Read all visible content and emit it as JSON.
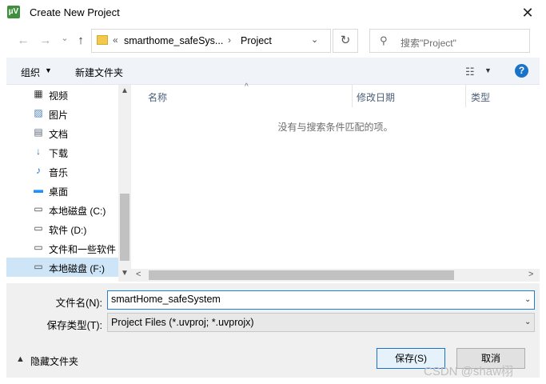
{
  "window": {
    "title": "Create New Project",
    "app_icon": "µV",
    "close_glyph": "✕"
  },
  "nav": {
    "back": "←",
    "forward": "→",
    "recent": "⌄",
    "up": "↑",
    "address": {
      "overflow": "«",
      "crumb1": "smarthome_safeSys...",
      "separator": "›",
      "crumb2": "Project",
      "dropdown": "⌄"
    },
    "refresh": "↻",
    "search_icon": "⚲",
    "search_placeholder": "搜索\"Project\""
  },
  "toolbar": {
    "organize": "组织",
    "organize_caret": "▼",
    "new_folder": "新建文件夹",
    "view_icon": "☷",
    "view_caret": "▼",
    "help": "?"
  },
  "sidebar": {
    "items": [
      {
        "label": "视频",
        "icon": "video-icon",
        "glyph": "▦",
        "color": "#333333"
      },
      {
        "label": "图片",
        "icon": "pictures-icon",
        "glyph": "▨",
        "color": "#4a7fb5"
      },
      {
        "label": "文档",
        "icon": "documents-icon",
        "glyph": "▤",
        "color": "#5a6a7a"
      },
      {
        "label": "下载",
        "icon": "downloads-icon",
        "glyph": "↓",
        "color": "#1a73c8"
      },
      {
        "label": "音乐",
        "icon": "music-icon",
        "glyph": "♪",
        "color": "#1a73c8"
      },
      {
        "label": "桌面",
        "icon": "desktop-icon",
        "glyph": "▬",
        "color": "#1e90ff"
      },
      {
        "label": "本地磁盘 (C:)",
        "icon": "system-drive-icon",
        "glyph": "▭",
        "color": "#444444"
      },
      {
        "label": "软件 (D:)",
        "icon": "drive-icon",
        "glyph": "▭",
        "color": "#444444"
      },
      {
        "label": "文件和一些软件",
        "icon": "drive-icon",
        "glyph": "▭",
        "color": "#444444"
      },
      {
        "label": "本地磁盘 (F:)",
        "icon": "drive-icon",
        "glyph": "▭",
        "color": "#444444",
        "selected": true
      }
    ],
    "scroll_up": "▲",
    "scroll_down": "▼"
  },
  "list": {
    "columns": [
      "名称",
      "修改日期",
      "类型"
    ],
    "sort_indicator": "^",
    "empty_message": "没有与搜索条件匹配的项。",
    "scroll_left": "<",
    "scroll_right": ">"
  },
  "form": {
    "filename_label": "文件名(N):",
    "filename_value": "smartHome_safeSystem",
    "filetype_label": "保存类型(T):",
    "filetype_value": "Project Files (*.uvproj; *.uvprojx)",
    "dropdown_glyph": "⌄"
  },
  "footer": {
    "hide_caret": "▲",
    "hide_folders": "隐藏文件夹",
    "save": "保存(S)",
    "cancel": "取消"
  },
  "watermark": "CSDN @shaw栩",
  "colors": {
    "accent": "#1a73c8",
    "selection": "#cde5f7",
    "toolbar_bg": "#f0f4f9"
  }
}
